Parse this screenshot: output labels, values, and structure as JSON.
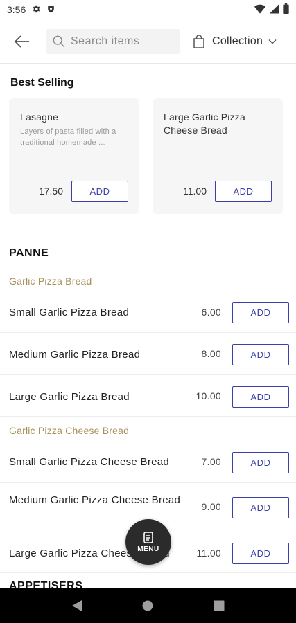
{
  "status_bar": {
    "time": "3:56"
  },
  "header": {
    "search_placeholder": "Search items",
    "collection_label": "Collection"
  },
  "best_selling": {
    "title": "Best Selling",
    "items": [
      {
        "name": "Lasagne",
        "description": "Layers of pasta filled with a traditional homemade ...",
        "price": "17.50",
        "add_label": "ADD"
      },
      {
        "name": "Large Garlic Pizza Cheese Bread",
        "description": "",
        "price": "11.00",
        "add_label": "ADD"
      }
    ]
  },
  "section": {
    "title": "PANNE",
    "categories": [
      {
        "title": "Garlic Pizza Bread",
        "items": [
          {
            "name": "Small Garlic Pizza Bread",
            "price": "6.00",
            "add_label": "ADD"
          },
          {
            "name": "Medium Garlic Pizza Bread",
            "price": "8.00",
            "add_label": "ADD"
          },
          {
            "name": "Large Garlic Pizza Bread",
            "price": "10.00",
            "add_label": "ADD"
          }
        ]
      },
      {
        "title": "Garlic Pizza Cheese Bread",
        "items": [
          {
            "name": "Small Garlic Pizza Cheese Bread",
            "price": "7.00",
            "add_label": "ADD"
          },
          {
            "name": "Medium Garlic Pizza Cheese Bread",
            "price": "9.00",
            "add_label": "ADD"
          },
          {
            "name": "Large Garlic Pizza Cheese Bread",
            "price": "11.00",
            "add_label": "ADD"
          }
        ]
      }
    ]
  },
  "next_section_title": "APPETISERS",
  "fab": {
    "label": "MENU"
  },
  "colors": {
    "accent": "#3a3fa9",
    "category": "#a88f5a",
    "fab": "#2b2b2b"
  }
}
